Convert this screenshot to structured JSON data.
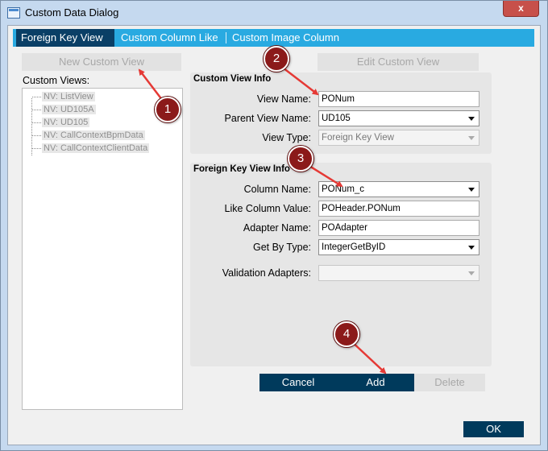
{
  "window": {
    "title": "Custom Data Dialog",
    "close_label": "x"
  },
  "tabs": [
    "Foreign Key View",
    "Custom Column Like",
    "Custom Image Column"
  ],
  "left": {
    "new_custom_view": "New Custom View",
    "custom_views_label": "Custom Views:",
    "tree_items": [
      "NV: ListView",
      "NV: UD105A",
      "NV: UD105",
      "NV: CallContextBpmData",
      "NV: CallContextClientData"
    ]
  },
  "edit_custom_view": "Edit Custom View",
  "custom_view_info": {
    "title": "Custom View Info",
    "view_name_label": "View Name:",
    "view_name_value": "PONum",
    "parent_view_label": "Parent View Name:",
    "parent_view_value": "UD105",
    "view_type_label": "View Type:",
    "view_type_value": "Foreign Key View"
  },
  "fk_view_info": {
    "title": "Foreign Key View Info",
    "column_name_label": "Column Name:",
    "column_name_value": "PONum_c",
    "like_column_label": "Like Column Value:",
    "like_column_value": "POHeader.PONum",
    "adapter_name_label": "Adapter Name:",
    "adapter_name_value": "POAdapter",
    "get_by_type_label": "Get By Type:",
    "get_by_type_value": "IntegerGetByID",
    "validation_label": "Validation Adapters:",
    "validation_value": ""
  },
  "buttons": {
    "cancel": "Cancel",
    "add": "Add",
    "delete": "Delete",
    "ok": "OK"
  },
  "callouts": [
    "1",
    "2",
    "3",
    "4"
  ],
  "colors": {
    "tab_strip": "#29aae1",
    "tab_active": "#0a3f66",
    "primary_button": "#003a5c",
    "callout": "#8b1a1a",
    "arrow": "#e53935"
  }
}
